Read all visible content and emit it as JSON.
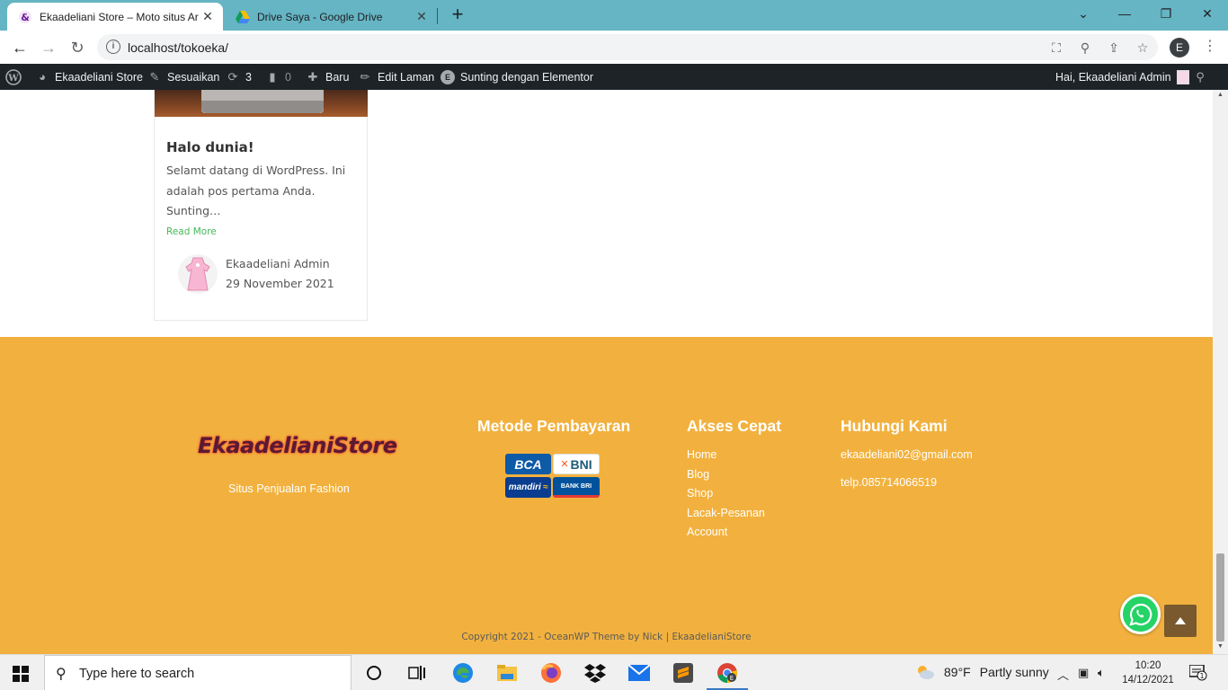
{
  "browser": {
    "tabs": [
      {
        "title": "Ekaadeliani Store – Moto situs Ar",
        "active": true,
        "icon": "store-favicon"
      },
      {
        "title": "Drive Saya - Google Drive",
        "active": false,
        "icon": "google-drive-icon"
      }
    ],
    "url": "localhost/tokoeka/",
    "profile_initial": "E"
  },
  "adminbar": {
    "site_name": "Ekaadeliani Store",
    "customize": "Sesuaikan",
    "updates_count": "3",
    "comments_count": "0",
    "new": "Baru",
    "edit_page": "Edit Laman",
    "elementor": "Sunting dengan Elementor",
    "greeting": "Hai, Ekaadeliani Admin"
  },
  "post": {
    "title": "Halo dunia!",
    "excerpt": "Selamt datang di WordPress. Ini adalah pos pertama Anda. Sunting…",
    "read_more": "Read More",
    "author": "Ekaadeliani Admin",
    "date": "29 November 2021"
  },
  "footer": {
    "brand": "EkaadelianiStore",
    "tagline": "Situs Penjualan Fashion",
    "payment_heading": "Metode Pembayaran",
    "banks": [
      "BCA",
      "BNI",
      "mandiri",
      "BANK BRI"
    ],
    "quick_heading": "Akses Cepat",
    "quick_links": [
      "Home",
      "Blog",
      "Shop",
      "Lacak-Pesanan",
      "Account"
    ],
    "contact_heading": "Hubungi Kami",
    "email": "ekaadeliani02@gmail.com",
    "phone": "telp.085714066519",
    "copyright": "Copyright 2021 - OceanWP Theme by Nick | EkaadelianiStore",
    "accent_color": "#f2b13e"
  },
  "taskbar": {
    "search_placeholder": "Type here to search",
    "weather_temp": "89°F",
    "weather_desc": "Partly sunny",
    "time": "10:20",
    "date": "14/12/2021",
    "notification_count": "1"
  }
}
